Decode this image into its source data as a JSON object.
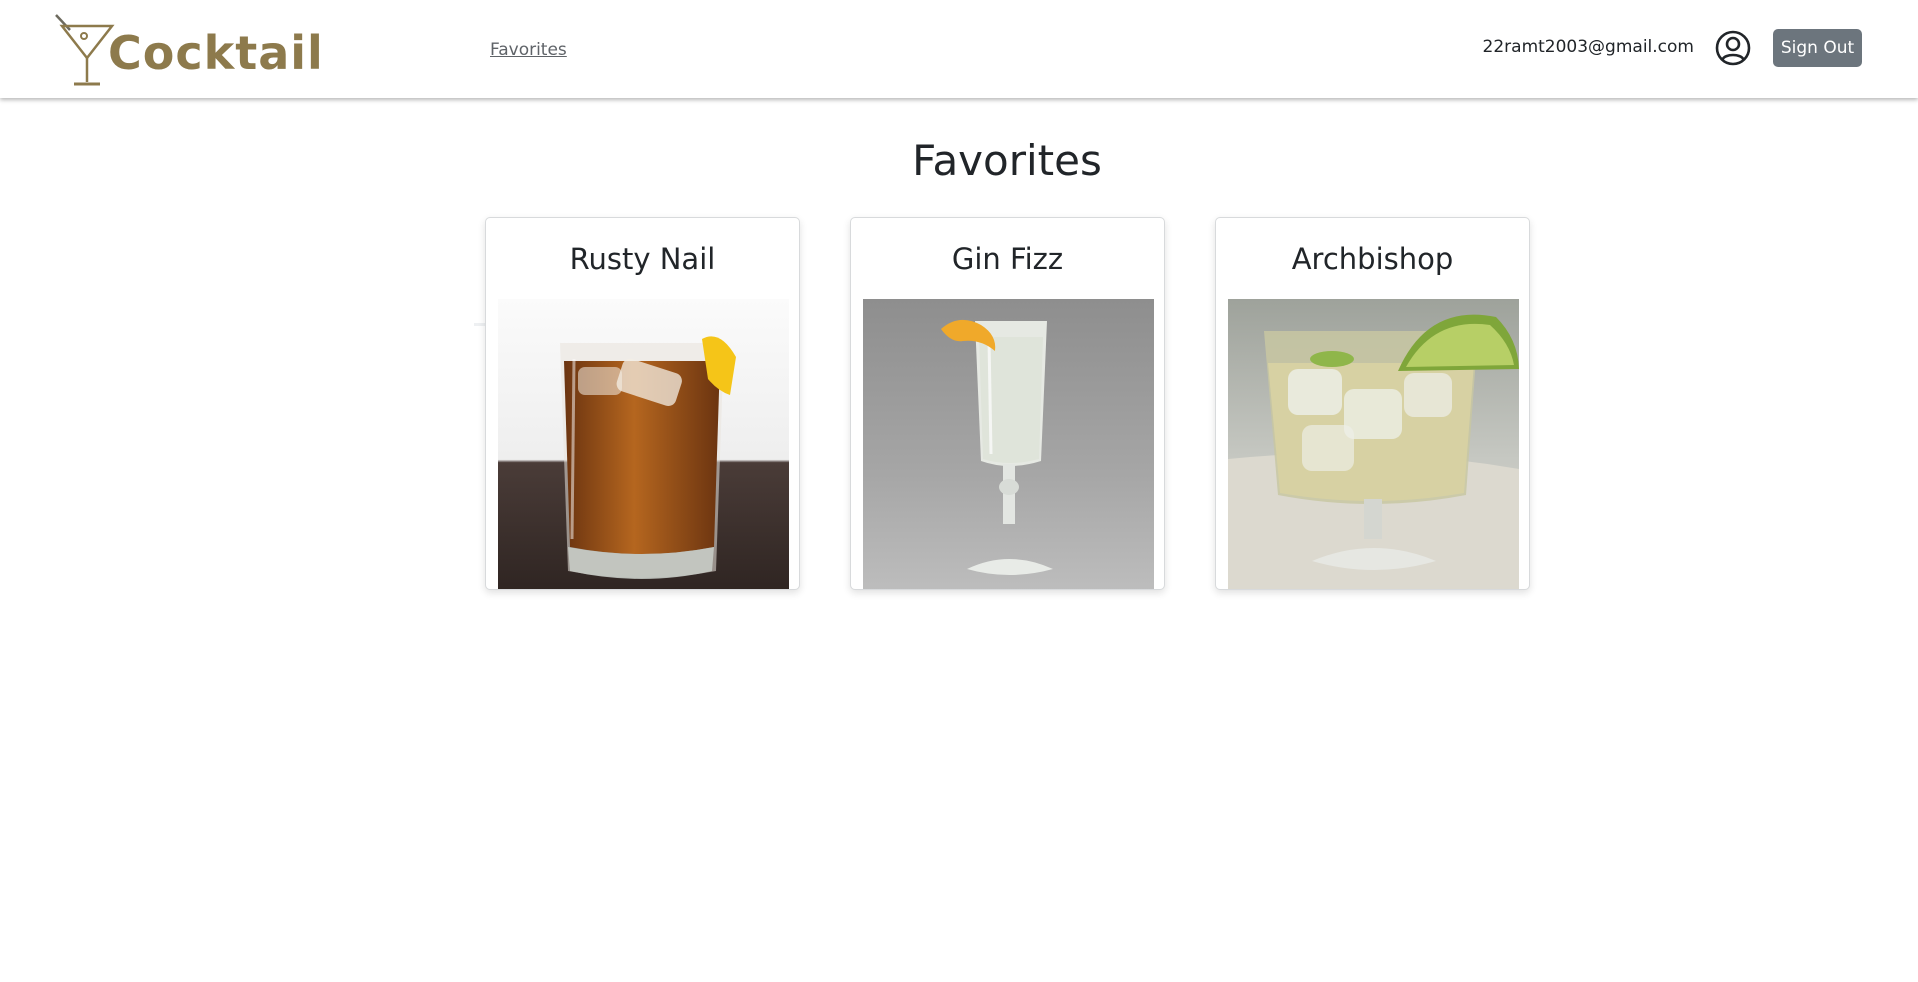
{
  "navbar": {
    "logo_text": "Cocktail",
    "favorites_link": "Favorites",
    "user_email": "22ramt2003@gmail.com",
    "user_icon": "user-circle-icon",
    "signout_label": "Sign Out"
  },
  "page": {
    "title": "Favorites"
  },
  "favorites": [
    {
      "name": "Rusty Nail",
      "image": "rusty-nail-drink-photo"
    },
    {
      "name": "Gin Fizz",
      "image": "gin-fizz-drink-photo"
    },
    {
      "name": "Archbishop",
      "image": "archbishop-drink-photo"
    }
  ],
  "colors": {
    "logo_gold": "#8d7a4c",
    "button_gray": "#6c757d",
    "link_gray": "#5f6368"
  }
}
